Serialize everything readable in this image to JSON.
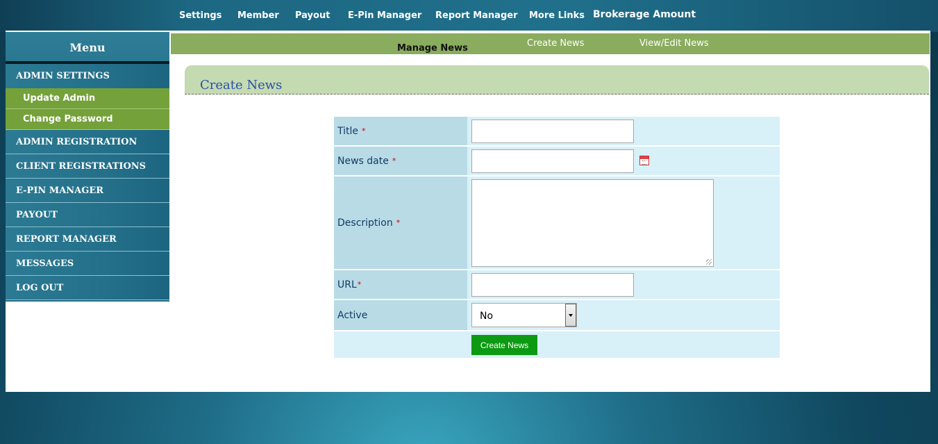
{
  "topnav": {
    "items": [
      "Settings",
      "Member",
      "Payout",
      "E-Pin Manager",
      "Report Manager",
      "More Links"
    ],
    "brokerage": "Brokerage Amount"
  },
  "sidebar": {
    "title": "Menu",
    "section": "ADMIN SETTINGS",
    "sub_items": [
      "Update Admin",
      "Change Password"
    ],
    "items": [
      "ADMIN REGISTRATION",
      "CLIENT REGISTRATIONS",
      "E-PIN MANAGER",
      "PAYOUT",
      "REPORT MANAGER",
      "MESSAGES",
      "LOG OUT"
    ]
  },
  "subbar": {
    "active": "Manage News",
    "links": [
      "Create News",
      "View/Edit News"
    ]
  },
  "panel": {
    "title": "Create News"
  },
  "form": {
    "title_label": "Title",
    "date_label": "News date",
    "description_label": "Description",
    "url_label": "URL",
    "active_label": "Active",
    "required_mark": "*",
    "active_value": "No",
    "submit_label": "Create News"
  },
  "colors": {
    "subbar_green": "#8aac5e",
    "sub_item_green": "#74a13a",
    "button_green": "#0c9a12",
    "panel_title_blue": "#2a4fa8"
  }
}
